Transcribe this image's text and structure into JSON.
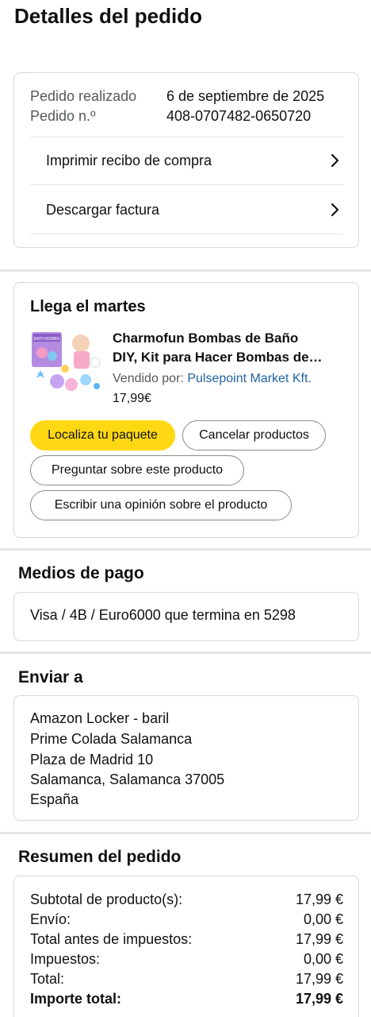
{
  "page": {
    "title": "Detalles del pedido"
  },
  "order_info": {
    "placed_label": "Pedido realizado",
    "placed_value": "6 de septiembre de 2025",
    "number_label": "Pedido n.º",
    "number_value": "408-0707482-0650720",
    "links": [
      {
        "label": "Imprimir recibo de compra",
        "icon": "chevron-right-icon"
      },
      {
        "label": "Descargar factura",
        "icon": "chevron-right-icon"
      }
    ]
  },
  "shipment": {
    "title": "Llega el martes",
    "product": {
      "name_line1": "Charmofun Bombas de Baño",
      "name_line2": "DIY, Kit para Hacer Bombas de…",
      "seller_label": "Vendido por:",
      "seller_name": "Pulsepoint Market Kft.",
      "price": "17,99€",
      "thumb_text": "BATH BOMBS"
    },
    "buttons": {
      "track": "Localiza tu paquete",
      "cancel": "Cancelar productos",
      "ask": "Preguntar sobre este producto",
      "review": "Escribir una opinión sobre el producto"
    }
  },
  "payment": {
    "title": "Medios de pago",
    "method": "Visa / 4B / Euro6000  que termina en 5298"
  },
  "ship_to": {
    "title": "Enviar a",
    "lines": [
      "Amazon Locker - baril",
      "Prime Colada Salamanca",
      "Plaza de Madrid 10",
      "Salamanca, Salamanca 37005",
      "España"
    ]
  },
  "summary": {
    "title": "Resumen del pedido",
    "rows": [
      {
        "label": "Subtotal de producto(s):",
        "value": "17,99 €"
      },
      {
        "label": "Envío:",
        "value": "0,00 €"
      },
      {
        "label": "Total antes de impuestos:",
        "value": "17,99 €"
      },
      {
        "label": "Impuestos:",
        "value": "0,00 €"
      },
      {
        "label": "Total:",
        "value": "17,99 €"
      },
      {
        "label": "Importe total:",
        "value": "17,99 €"
      }
    ]
  },
  "colors": {
    "accent_yellow": "#ffd814",
    "link_blue": "#2162a1",
    "border": "#d5d9d9"
  }
}
